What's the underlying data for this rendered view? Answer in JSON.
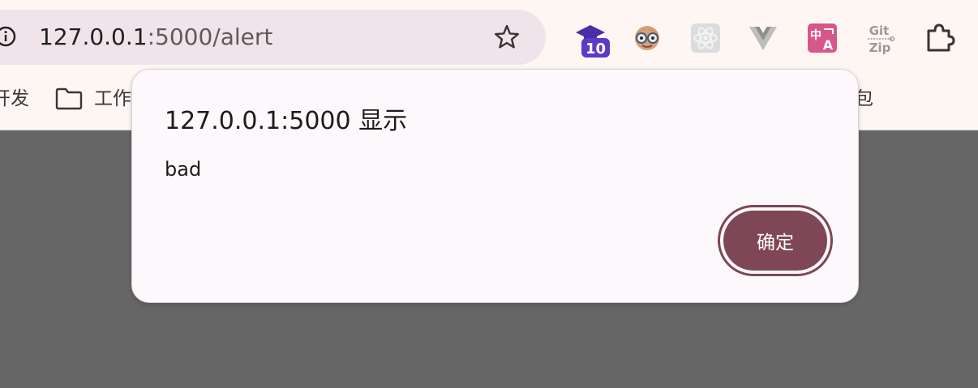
{
  "browser": {
    "url_host": "127.0.0.1",
    "url_path": ":5000/alert",
    "extension_badge": "10",
    "icons": [
      "info-icon",
      "star-icon",
      "graduation-cap-icon",
      "mascot-icon",
      "react-icon",
      "vue-icon",
      "translate-icon",
      "git-zip-icon",
      "extensions-puzzle-icon"
    ],
    "git_zip_line1": "Git",
    "git_zip_line2": "Zip"
  },
  "bookmarks": {
    "item1_label": "开发",
    "item2_label": "工作",
    "item3_label": "包"
  },
  "dialog": {
    "title": "127.0.0.1:5000 显示",
    "message": "bad",
    "ok_label": "确定"
  },
  "colors": {
    "page_overlay": "#666666",
    "dialog_bg": "#fcf8fb",
    "primary_button": "#7f4656",
    "toolbar_bg": "#fdf6f3",
    "omnibox_bg": "#f0e4ea"
  }
}
